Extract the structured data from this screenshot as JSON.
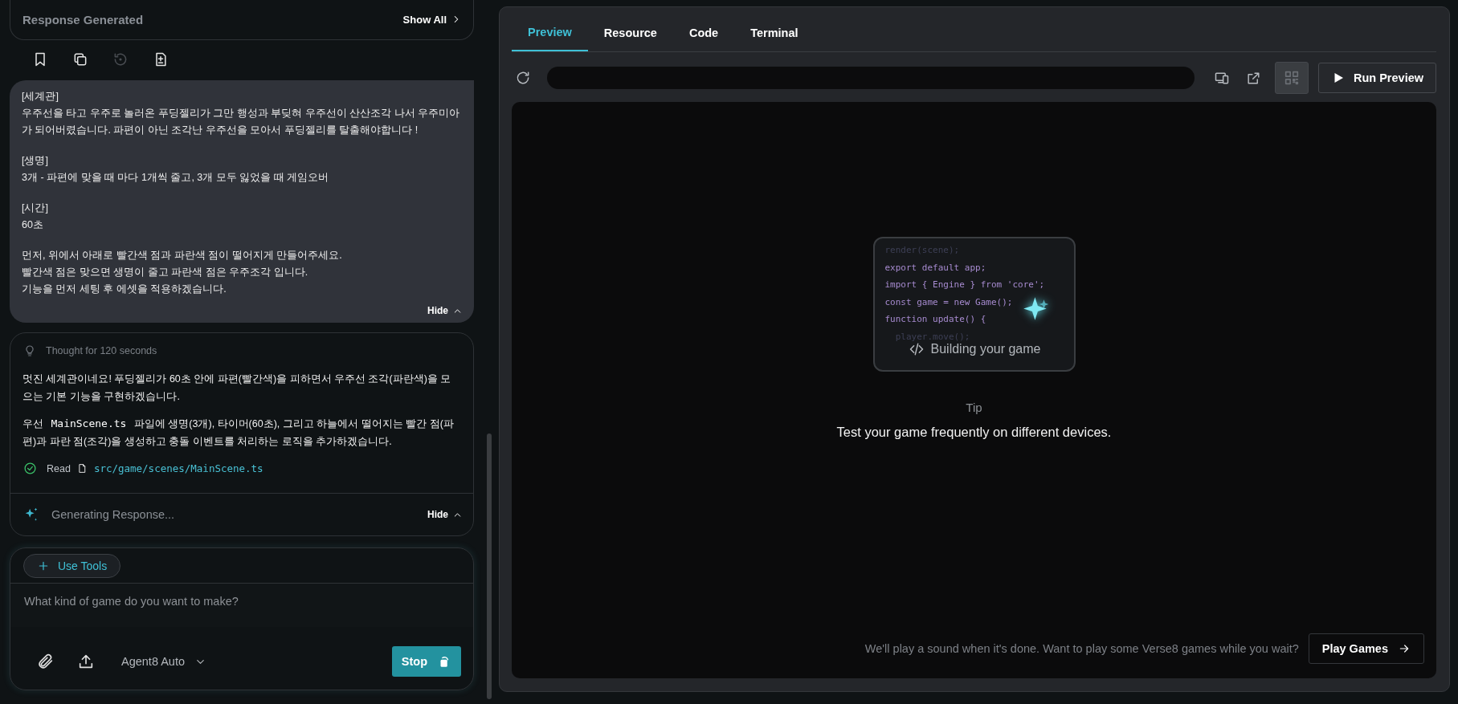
{
  "chat": {
    "response_header": {
      "title": "Response Generated",
      "action": "Show All"
    },
    "message_actions": [
      {
        "kind": "bookmark",
        "disabled": false
      },
      {
        "kind": "copy",
        "disabled": false
      },
      {
        "kind": "retry",
        "disabled": true
      },
      {
        "kind": "diff",
        "disabled": false
      }
    ],
    "user_message": {
      "paragraphs": [
        [
          "[세계관]",
          "우주선을 타고 우주로 놀러온 푸딩젤리가 그만 행성과 부딪혀 우주선이 산산조각 나서 우주미아가 되어버렸습니다. 파편이 아닌 조각난 우주선을 모아서 푸딩젤리를 탈출해야합니다 !"
        ],
        [
          "[생명]",
          "3개 - 파편에 맞을 때 마다 1개씩 줄고, 3개 모두 잃었을 때 게임오버"
        ],
        [
          "[시간]",
          "60초"
        ],
        [
          "먼저, 위에서 아래로 빨간색 점과 파란색 점이 떨어지게 만들어주세요.",
          "빨간색 점은 맞으면 생명이 줄고 파란색 점은 우주조각 입니다.",
          "기능을 먼저 세팅 후 에셋을 적용하겠습니다."
        ]
      ],
      "toggle": "Hide"
    },
    "assistant": {
      "thought": "Thought for 120 seconds",
      "paragraphs": [
        {
          "before": "멋진 세계관이네요! 푸딩젤리가 60초 안에 파편(빨간색)을 피하면서 우주선 조각(파란색)을 모으는 기본 기능을 구현하겠습니다."
        },
        {
          "before": "우선 ",
          "code": "MainScene.ts",
          "after": " 파일에 생명(3개), 타이머(60초), 그리고 하늘에서 떨어지는 빨간 점(파편)과 파란 점(조각)을 생성하고 충돌 이벤트를 처리하는 로직을 추가하겠습니다."
        }
      ],
      "tool_call": {
        "action": "Read",
        "path": "src/game/scenes/MainScene.ts"
      },
      "generating": "Generating Response...",
      "toggle": "Hide"
    },
    "composer": {
      "tools_button": "Use Tools",
      "placeholder": "What kind of game do you want to make?",
      "model": "Agent8 Auto",
      "stop_button": "Stop"
    }
  },
  "preview": {
    "tabs": [
      {
        "label": "Preview",
        "selected": true
      },
      {
        "label": "Resource",
        "selected": false
      },
      {
        "label": "Code",
        "selected": false
      },
      {
        "label": "Terminal",
        "selected": false
      }
    ],
    "toolbar": {
      "qr_active": true,
      "run_button": "Run Preview"
    },
    "building_card": {
      "code_lines": [
        {
          "text": "render(scene);",
          "kind": "faded"
        },
        {
          "text": "export default app;",
          "kind": "plain"
        },
        {
          "text": "import { Engine } from 'core';",
          "kind": "plain"
        },
        {
          "text": "const game = new Game();",
          "kind": "plain"
        },
        {
          "text": "function update() {",
          "kind": "plain"
        },
        {
          "text": "  player.move();",
          "kind": "faded"
        }
      ],
      "caption": "Building your game"
    },
    "tip": {
      "label": "Tip",
      "text": "Test your game frequently on different devices."
    },
    "footer": {
      "text": "We'll play a sound when it's done. Want to play some Verse8 games while you wait?",
      "button": "Play Games"
    }
  }
}
